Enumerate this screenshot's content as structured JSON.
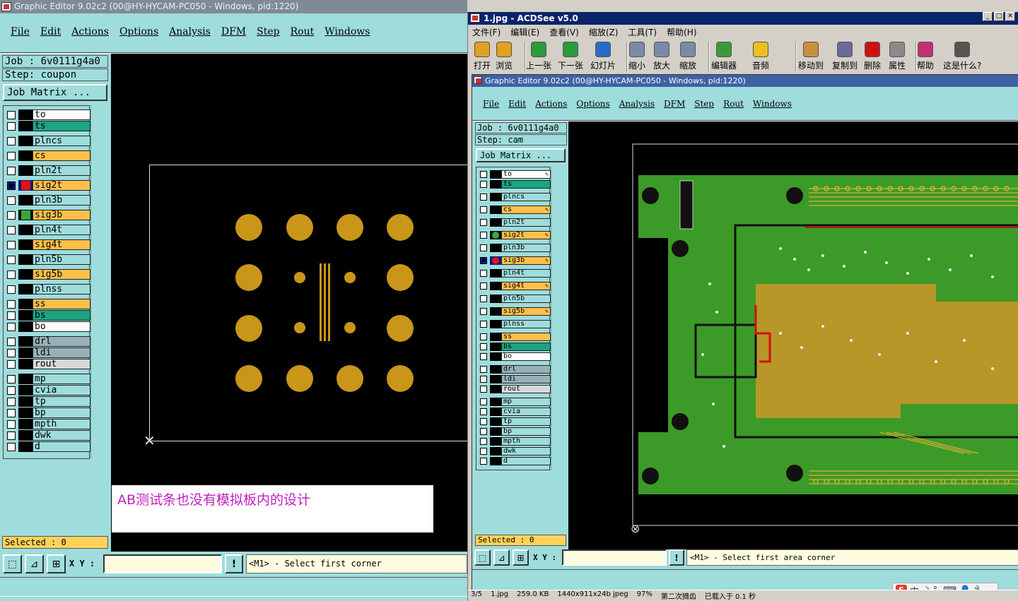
{
  "left_window": {
    "title": "Graphic Editor 9.02c2 (00@HY-HYCAM-PC050 - Windows, pid:1220)",
    "menu": [
      "File",
      "Edit",
      "Actions",
      "Options",
      "Analysis",
      "DFM",
      "Step",
      "Rout",
      "Windows"
    ],
    "job": "Job : 6v0111g4a0",
    "step": "Step: coupon",
    "job_matrix": "Job Matrix ...",
    "layers": [
      {
        "name": "to",
        "color": "#ffffff"
      },
      {
        "name": "ts",
        "color": "#1aa57f"
      },
      {
        "name": "plncs",
        "color": "#9fdcdc"
      },
      {
        "name": "cs",
        "color": "#ffc04a"
      },
      {
        "name": "pln2t",
        "color": "#9fdcdc"
      },
      {
        "name": "sig2t",
        "color": "#ffc04a",
        "indicator": "#e81010",
        "selected": true
      },
      {
        "name": "pln3b",
        "color": "#9fdcdc"
      },
      {
        "name": "sig3b",
        "color": "#ffc04a",
        "indicator": "#3aa63a"
      },
      {
        "name": "pln4t",
        "color": "#9fdcdc"
      },
      {
        "name": "sig4t",
        "color": "#ffc04a"
      },
      {
        "name": "pln5b",
        "color": "#9fdcdc"
      },
      {
        "name": "sig5b",
        "color": "#ffc04a"
      },
      {
        "name": "plnss",
        "color": "#9fdcdc"
      },
      {
        "name": "ss",
        "color": "#ffc04a"
      },
      {
        "name": "bs",
        "color": "#1aa57f"
      },
      {
        "name": "bo",
        "color": "#ffffff"
      },
      {
        "name": "drl",
        "color": "#98b0b8"
      },
      {
        "name": "ldi",
        "color": "#98b0b8"
      },
      {
        "name": "rout",
        "color": "#d8d8d8"
      },
      {
        "name": "mp",
        "color": "#9fdcdc"
      },
      {
        "name": "cvia",
        "color": "#9fdcdc"
      },
      {
        "name": "tp",
        "color": "#9fdcdc"
      },
      {
        "name": "bp",
        "color": "#9fdcdc"
      },
      {
        "name": "mpth",
        "color": "#9fdcdc"
      },
      {
        "name": "dwk",
        "color": "#9fdcdc"
      },
      {
        "name": "d",
        "color": "#9fdcdc"
      }
    ],
    "annotation": "AB测试条也没有模拟板内的设计",
    "selected": "Selected : 0",
    "xy_label": "X Y :",
    "xy_value": "",
    "message": "<M1> - Select first corner"
  },
  "right_window": {
    "title": "1.jpg - ACDSee v5.0",
    "menu": [
      "文件(F)",
      "编辑(E)",
      "查看(V)",
      "缩放(Z)",
      "工具(T)",
      "帮助(H)"
    ],
    "toolbar": [
      {
        "label": "打开",
        "icon": "open-folder-icon",
        "color": "#e0a020"
      },
      {
        "label": "浏览",
        "icon": "browse-icon",
        "color": "#e0a020"
      },
      {
        "label": "上一张",
        "icon": "previous-image-icon",
        "color": "#2a9a3a"
      },
      {
        "label": "下一张",
        "icon": "next-image-icon",
        "color": "#2a9a3a"
      },
      {
        "label": "幻灯片",
        "icon": "slideshow-icon",
        "color": "#2a6ac8"
      },
      {
        "label": "缩小",
        "icon": "zoom-out-icon",
        "color": "#7a8aa8"
      },
      {
        "label": "放大",
        "icon": "zoom-in-icon",
        "color": "#7a8aa8"
      },
      {
        "label": "缩放",
        "icon": "zoom-icon",
        "color": "#7a8aa8"
      },
      {
        "label": "编辑器",
        "icon": "editor-icon",
        "color": "#3a9a3a"
      },
      {
        "label": "音频",
        "icon": "audio-icon",
        "color": "#e8c020"
      },
      {
        "label": "移动到",
        "icon": "move-to-icon",
        "color": "#c89040"
      },
      {
        "label": "复制到",
        "icon": "copy-to-icon",
        "color": "#6a6a9a"
      },
      {
        "label": "删除",
        "icon": "delete-icon",
        "color": "#d01010"
      },
      {
        "label": "属性",
        "icon": "properties-icon",
        "color": "#8a8a8a"
      },
      {
        "label": "帮助",
        "icon": "help-book-icon",
        "color": "#c03070"
      },
      {
        "label": "这是什么?",
        "icon": "whats-this-icon",
        "color": "#555555"
      }
    ],
    "inner_title": "Graphic Editor 9.02c2 (00@HY-HYCAM-PC050 - Windows, pid:1220)",
    "inner_menu": [
      "File",
      "Edit",
      "Actions",
      "Options",
      "Analysis",
      "DFM",
      "Step",
      "Rout",
      "Windows"
    ],
    "job": "Job : 6v0111g4a0",
    "step": "Step: cam",
    "job_matrix": "Job Matrix ...",
    "layers": [
      {
        "name": "to",
        "color": "#ffffff",
        "edit": true
      },
      {
        "name": "ts",
        "color": "#1aa57f"
      },
      {
        "name": "plncs",
        "color": "#9fdcdc"
      },
      {
        "name": "cs",
        "color": "#ffc04a",
        "edit": true
      },
      {
        "name": "pln2t",
        "color": "#9fdcdc"
      },
      {
        "name": "sig2t",
        "color": "#ffc04a",
        "indicator": "#3aa63a",
        "edit": true
      },
      {
        "name": "pln3b",
        "color": "#9fdcdc"
      },
      {
        "name": "sig3b",
        "color": "#ffc04a",
        "indicator": "#e81010",
        "selected": true,
        "edit": true
      },
      {
        "name": "pln4t",
        "color": "#9fdcdc"
      },
      {
        "name": "sig4t",
        "color": "#ffc04a",
        "edit": true
      },
      {
        "name": "pln5b",
        "color": "#9fdcdc"
      },
      {
        "name": "sig5b",
        "color": "#ffc04a",
        "edit": true
      },
      {
        "name": "plnss",
        "color": "#9fdcdc"
      },
      {
        "name": "ss",
        "color": "#ffc04a"
      },
      {
        "name": "bs",
        "color": "#1aa57f"
      },
      {
        "name": "bo",
        "color": "#ffffff"
      },
      {
        "name": "drl",
        "color": "#98b0b8"
      },
      {
        "name": "ldi",
        "color": "#98b0b8"
      },
      {
        "name": "rout",
        "color": "#d8d8d8"
      },
      {
        "name": "mp",
        "color": "#9fdcdc"
      },
      {
        "name": "cvia",
        "color": "#9fdcdc"
      },
      {
        "name": "tp",
        "color": "#9fdcdc"
      },
      {
        "name": "bp",
        "color": "#9fdcdc"
      },
      {
        "name": "mpth",
        "color": "#9fdcdc"
      },
      {
        "name": "dwk",
        "color": "#9fdcdc"
      },
      {
        "name": "d",
        "color": "#9fdcdc"
      }
    ],
    "selected": "Selected : 0",
    "xy_label": "X Y :",
    "message": "<M1> - Select first area corner",
    "taskbar": [
      "3/5",
      "1.jpg",
      "259.0 KB",
      "1440x911x24b jpeg",
      "97%",
      "第二次摘齿",
      "已载入于 0.1 秒"
    ],
    "ime_label": "中"
  },
  "colors": {
    "teal": "#9fdcdc",
    "gold": "#c9961a",
    "board_green": "#3c9a28",
    "board_gold": "#b89628"
  }
}
